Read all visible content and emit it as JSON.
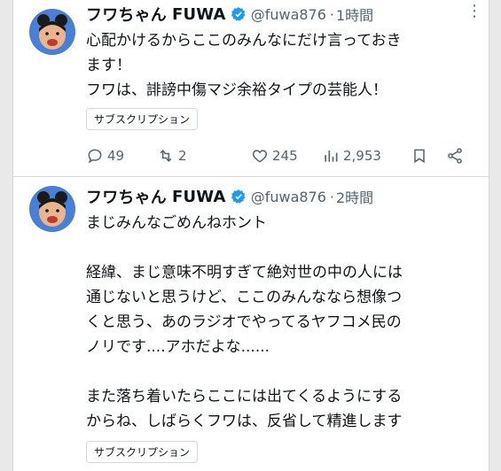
{
  "tweets": [
    {
      "name": "フワちゃん",
      "name_latin": "FUWA",
      "handle": "@fuwa876",
      "separator": "·",
      "time": "1時間",
      "text": "心配かけるからここのみんなにだけ言っておき\nます！\nフワは、誹謗中傷マジ余裕タイプの芸能人！",
      "badge": "サブスクリプション",
      "stats": {
        "replies": "49",
        "retweets": "2",
        "likes": "245",
        "views": "2,953"
      }
    },
    {
      "name": "フワちゃん",
      "name_latin": "FUWA",
      "handle": "@fuwa876",
      "separator": "·",
      "time": "2時間",
      "text": "まじみんなごめんねホント\n\n経緯、まじ意味不明すぎて絶対世の中の人には\n通じないと思うけど、ここのみんななら想像つ\nくと思う、あのラジオでやってるヤフコメ民の\nノリです....アホだよな......\n\nまた落ち着いたらここには出てくるようにする\nからね、しばらくフワは、反省して精進します",
      "badge": "サブスクリプション"
    }
  ],
  "colors": {
    "accent": "#1d9bf0",
    "secondary_text": "#536471",
    "avatar_bg": "#4a7fd6"
  },
  "icons": [
    "verified-badge-icon",
    "more-options-icon",
    "reply-icon",
    "retweet-icon",
    "like-icon",
    "views-icon",
    "bookmark-icon",
    "share-icon"
  ]
}
